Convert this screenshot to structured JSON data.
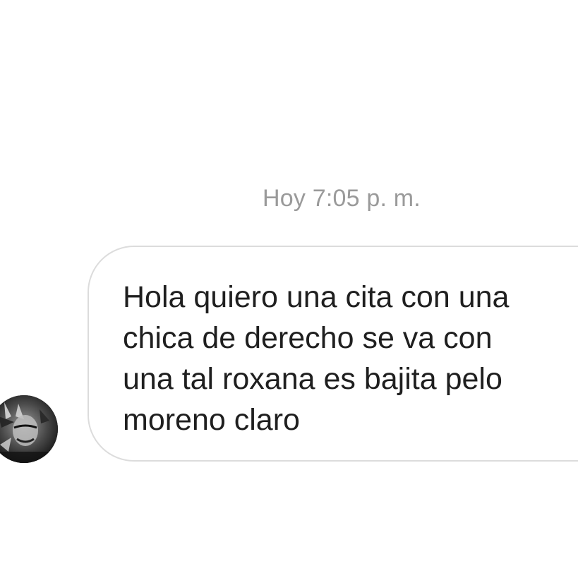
{
  "conversation": {
    "timestamp": "Hoy 7:05 p. m.",
    "messages": [
      {
        "direction": "incoming",
        "avatar_icon": "user-avatar-icon",
        "text": "Hola quiero una cita con una\nchica de derecho se va con\nuna tal roxana es bajita pelo\nmoreno claro"
      }
    ]
  },
  "colors": {
    "background": "#ffffff",
    "timestamp_text": "#9a9a9a",
    "bubble_border": "#dcdcdc",
    "message_text": "#1f1f1f"
  }
}
